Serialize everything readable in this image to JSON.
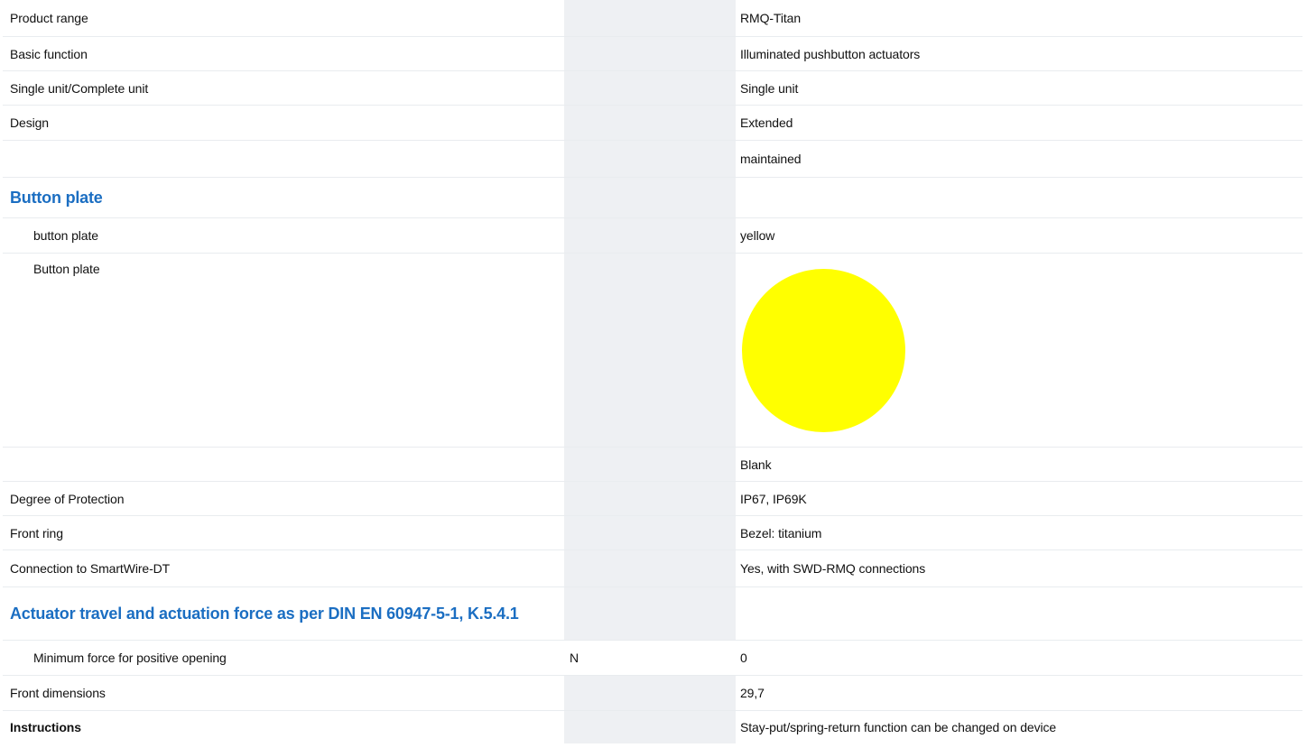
{
  "rows": [
    {
      "label": "Product range",
      "unit": "",
      "value": "RMQ-Titan"
    },
    {
      "label": "Basic function",
      "unit": "",
      "value": "Illuminated pushbutton actuators"
    },
    {
      "label": "Single unit/Complete unit",
      "unit": "",
      "value": "Single unit"
    },
    {
      "label": "Design",
      "unit": "",
      "value": "Extended"
    },
    {
      "label": "",
      "unit": "",
      "value": "maintained"
    }
  ],
  "section_button_plate": {
    "title": "Button plate",
    "color_label": "button plate",
    "color_value": "yellow",
    "image_label": "Button plate",
    "swatch_color": "#ffff00",
    "blank_value": "Blank"
  },
  "rows2": [
    {
      "label": "Degree of Protection",
      "unit": "",
      "value": "IP67, IP69K"
    },
    {
      "label": "Front ring",
      "unit": "",
      "value": "Bezel: titanium"
    },
    {
      "label": "Connection to SmartWire-DT",
      "unit": "",
      "value": "Yes, with SWD-RMQ connections"
    }
  ],
  "section_actuator": {
    "title": "Actuator travel and actuation force as per DIN EN 60947-5-1, K.5.4.1",
    "force_label": "Minimum force for positive opening",
    "force_unit": "N",
    "force_value": "0"
  },
  "front_dimensions": {
    "label": "Front dimensions",
    "value": "29,7"
  },
  "instructions": {
    "label": "Instructions",
    "value": "Stay-put/spring-return function can be changed on device"
  },
  "colors": {
    "accent": "#1b6ec2",
    "unit_column_bg": "#eef0f3",
    "row_divider": "#e9ecef"
  }
}
